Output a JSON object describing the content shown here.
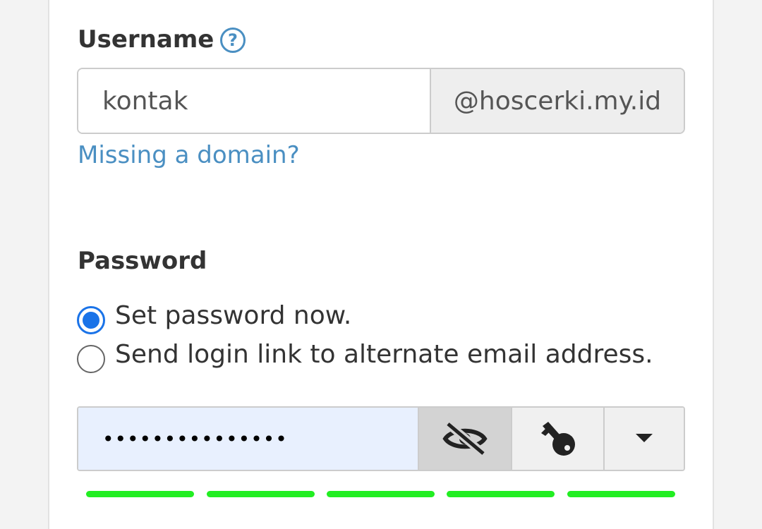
{
  "username": {
    "label": "Username",
    "help_glyph": "?",
    "value": "kontak",
    "domain": "@hoscerki.my.id",
    "missing_domain_link": "Missing a domain?"
  },
  "password": {
    "label": "Password",
    "options": [
      {
        "label": "Set password now.",
        "checked": true
      },
      {
        "label": "Send login link to alternate email address.",
        "checked": false
      }
    ],
    "masked_value": "•••••••••••••••",
    "strength_segments": 5,
    "strength_filled": 5,
    "strength_color": "#22ee22"
  },
  "colors": {
    "link": "#4a8fc2",
    "radio_checked": "#1a73e8",
    "autofill_bg": "#e8f0fe"
  },
  "icons": {
    "help": "question-circle-icon",
    "toggle_visibility": "eye-slash-icon",
    "generate": "key-icon",
    "menu": "caret-down-icon"
  }
}
